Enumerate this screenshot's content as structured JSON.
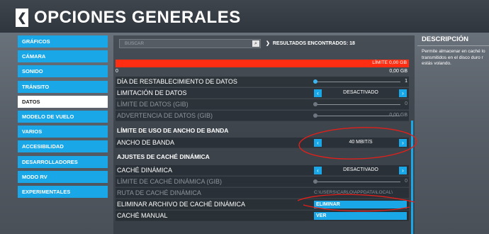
{
  "header": {
    "back_glyph": "❮",
    "title": "OPCIONES GENERALES"
  },
  "sidebar": {
    "items": [
      {
        "label": "GRÁFICOS",
        "active": false
      },
      {
        "label": "CÁMARA",
        "active": false
      },
      {
        "label": "SONIDO",
        "active": false
      },
      {
        "label": "TRÁNSITO",
        "active": false
      },
      {
        "label": "DATOS",
        "active": true
      },
      {
        "label": "MODELO DE VUELO",
        "active": false
      },
      {
        "label": "VARIOS",
        "active": false
      },
      {
        "label": "ACCESIBILIDAD",
        "active": false
      },
      {
        "label": "DESARROLLADORES",
        "active": false
      },
      {
        "label": "MODO RV",
        "active": false
      },
      {
        "label": "EXPERIMENTALES",
        "active": false
      }
    ]
  },
  "search": {
    "placeholder": "BUSCAR",
    "icon": "magnifier-icon"
  },
  "results": {
    "chevron": "❯",
    "text": "RESULTADOS ENCONTRADOS: 18"
  },
  "limit_bar": {
    "label": "LÍMITE 0,00 GB",
    "min": "0",
    "max": "0,00 GB",
    "color": "#ff2d12"
  },
  "settings": {
    "dia_restablecimiento": {
      "label": "DÍA DE RESTABLECIMIENTO DE DATOS",
      "value": "1"
    },
    "limitacion_datos": {
      "label": "LIMITACIÓN DE DATOS",
      "value": "DESACTIVADO"
    },
    "limite_datos": {
      "label": "LÍMITE DE DATOS (GIB)",
      "value": "0"
    },
    "advertencia_datos": {
      "label": "ADVERTENCIA DE DATOS (GIB)",
      "value": "0,00 GB"
    },
    "section_ancho": "LÍMITE DE USO DE ANCHO DE BANDA",
    "ancho_banda": {
      "label": "ANCHO DE BANDA",
      "value": "40 MBIT/S"
    },
    "section_cache": "AJUSTES DE CACHÉ DINÁMICA",
    "cache_dinamica": {
      "label": "CACHÉ DINÁMICA",
      "value": "DESACTIVADO"
    },
    "limite_cache": {
      "label": "LÍMITE DE CACHÉ DINÁMICA (GIB)",
      "value": "0"
    },
    "ruta_cache": {
      "label": "RUTA DE CACHÉ DINÁMICA",
      "value": "C:\\USERS\\CARLO\\APPDATA\\LOCAL\\"
    },
    "eliminar_cache": {
      "label": "ELIMINAR ARCHIVO DE CACHÉ DINÁMICA",
      "button": "ELIMINAR"
    },
    "cache_manual": {
      "label": "CACHÉ MANUAL",
      "button": "VER"
    }
  },
  "description": {
    "title": "DESCRIPCIÓN",
    "lines": [
      "Permite almacenar en caché lo",
      "transmitidos en el disco duro r",
      "estás volando."
    ]
  },
  "colors": {
    "accent": "#1aa7e8",
    "annotation": "#e0201a"
  }
}
